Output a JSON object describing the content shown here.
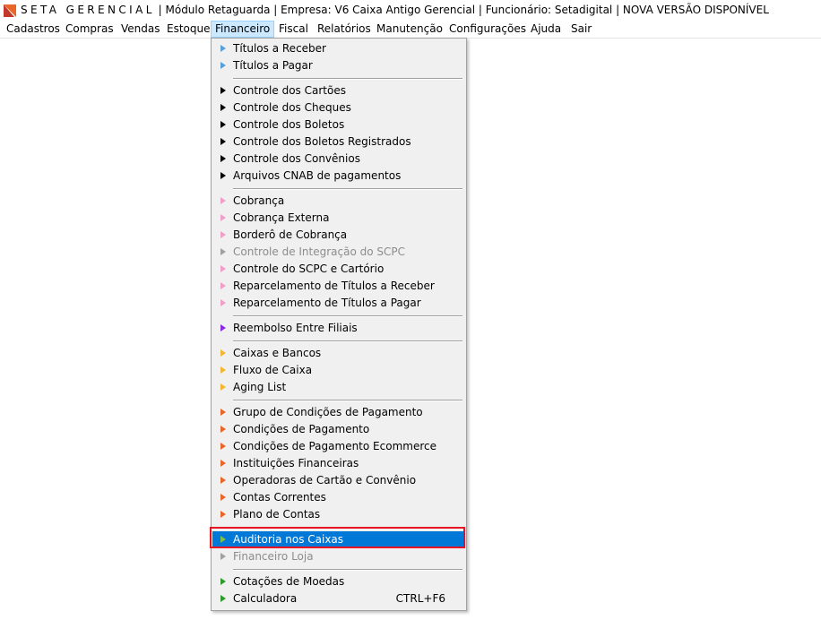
{
  "titlebar": {
    "brand": "SETA GERENCIAL",
    "info": "| Módulo Retaguarda | Empresa: V6 Caixa Antigo Gerencial | Funcionário: Setadigital  |  NOVA  VERSÃO  DISPONÍVEL"
  },
  "menubar": [
    {
      "label": "Cadastros"
    },
    {
      "label": "Compras"
    },
    {
      "label": "Vendas"
    },
    {
      "label": "Estoque"
    },
    {
      "label": "Financeiro"
    },
    {
      "label": "Fiscal"
    },
    {
      "label": "Relatórios"
    },
    {
      "label": "Manutenção"
    },
    {
      "label": "Configurações"
    },
    {
      "label": "Ajuda"
    },
    {
      "label": "Sair"
    }
  ],
  "colors": {
    "blue": "#5aa0d8",
    "black": "#000000",
    "pink": "#f0a0c8",
    "disabled": "#a0a0a0",
    "purple": "#8a2be2",
    "yellow": "#f2b632",
    "orange": "#e8662a",
    "green": "#2e9a2e",
    "highlight": "#0078d7",
    "annotation": "#e81123"
  },
  "financeiro_menu": [
    {
      "label": "Títulos a Receber",
      "color": "#5aa0d8"
    },
    {
      "label": "Títulos a Pagar",
      "color": "#5aa0d8"
    },
    {
      "label": "Controle dos Cartões",
      "color": "#000000"
    },
    {
      "label": "Controle dos Cheques",
      "color": "#000000"
    },
    {
      "label": "Controle dos Boletos",
      "color": "#000000"
    },
    {
      "label": "Controle dos Boletos Registrados",
      "color": "#000000"
    },
    {
      "label": "Controle dos Convênios",
      "color": "#000000"
    },
    {
      "label": "Arquivos CNAB de pagamentos",
      "color": "#000000"
    },
    {
      "label": "Cobrança",
      "color": "#f0a0c8"
    },
    {
      "label": "Cobrança Externa",
      "color": "#f0a0c8"
    },
    {
      "label": "Borderô de Cobrança",
      "color": "#f0a0c8"
    },
    {
      "label": "Controle de Integração do SCPC",
      "color": "#a0a0a0"
    },
    {
      "label": "Controle do SCPC e Cartório",
      "color": "#f0a0c8"
    },
    {
      "label": "Reparcelamento de Títulos a Receber",
      "color": "#f0a0c8"
    },
    {
      "label": "Reparcelamento de Títulos a Pagar",
      "color": "#f0a0c8"
    },
    {
      "label": "Reembolso Entre Filiais",
      "color": "#8a2be2"
    },
    {
      "label": "Caixas e Bancos",
      "color": "#f2b632"
    },
    {
      "label": "Fluxo de Caixa",
      "color": "#f2b632"
    },
    {
      "label": "Aging List",
      "color": "#f2b632"
    },
    {
      "label": "Grupo de Condições de Pagamento",
      "color": "#e8662a"
    },
    {
      "label": "Condições de Pagamento",
      "color": "#e8662a"
    },
    {
      "label": "Condições de Pagamento Ecommerce",
      "color": "#e8662a"
    },
    {
      "label": "Instituições Financeiras",
      "color": "#e8662a"
    },
    {
      "label": "Operadoras de Cartão e Convênio",
      "color": "#e8662a"
    },
    {
      "label": "Contas Correntes",
      "color": "#e8662a"
    },
    {
      "label": "Plano de Contas",
      "color": "#e8662a"
    },
    {
      "label": "Auditoria nos Caixas",
      "color": "#7cc04a"
    },
    {
      "label": "Financeiro Loja",
      "color": "#a0a0a0"
    },
    {
      "label": "Cotações de Moedas",
      "color": "#2e9a2e"
    },
    {
      "label": "Calculadora",
      "color": "#2e9a2e",
      "shortcut": "CTRL+F6"
    }
  ]
}
